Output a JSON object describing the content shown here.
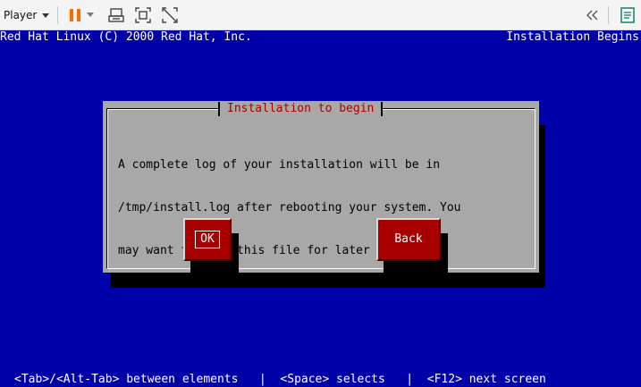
{
  "toolbar": {
    "player_label": "Player",
    "icons": [
      "pause-icon",
      "dropdown-caret-icon",
      "send-ctrl-alt-del-icon",
      "fit-guest-icon",
      "exit-fullscreen-icon",
      "collapse-toolbar-icon",
      "notes-icon"
    ],
    "accent_color": "#ff6a00"
  },
  "console": {
    "background_color": "#0000a8",
    "header_left": "Red Hat Linux (C) 2000 Red Hat, Inc.",
    "header_right": "Installation Begins",
    "dialog": {
      "title": "Installation to begin",
      "message_lines": [
        "A complete log of your installation will be in",
        "/tmp/install.log after rebooting your system. You",
        "may want to keep this file for later reference."
      ],
      "ok_label": "OK",
      "back_label": "Back",
      "title_color": "#a80000",
      "button_color": "#a80000",
      "panel_color": "#a8a8a8"
    },
    "status_line": "<Tab>/<Alt-Tab> between elements   |  <Space> selects   |  <F12> next screen"
  }
}
